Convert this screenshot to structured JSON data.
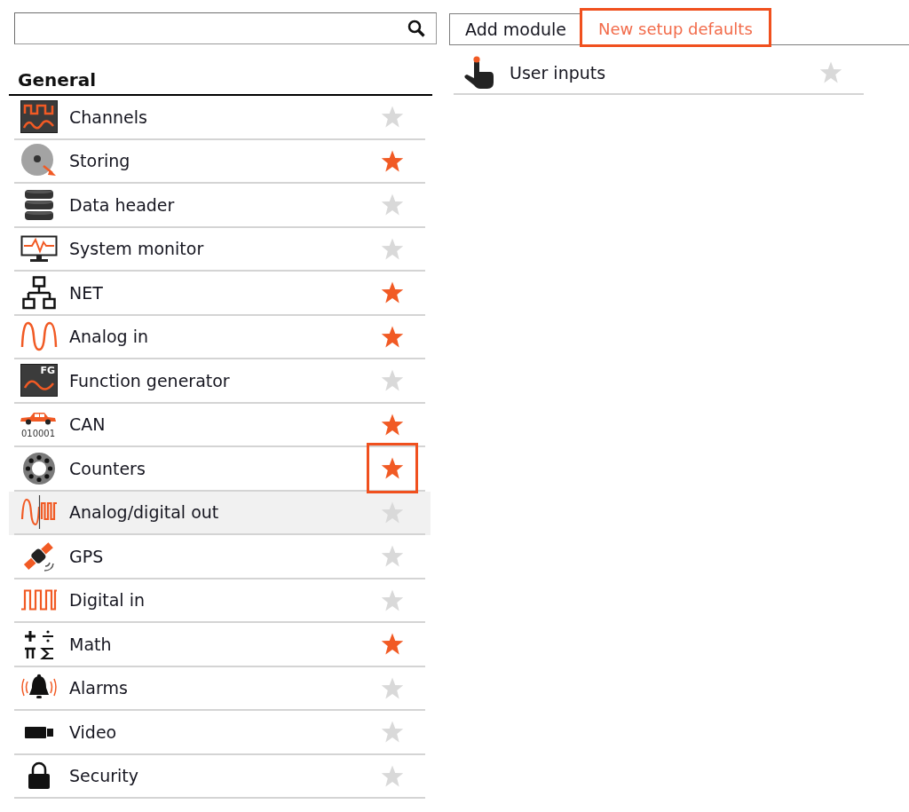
{
  "sidebar": {
    "title": "General",
    "items": [
      {
        "label": "Channels",
        "favorite": false,
        "selected": false,
        "highlighted": false
      },
      {
        "label": "Storing",
        "favorite": true,
        "selected": false,
        "highlighted": false
      },
      {
        "label": "Data header",
        "favorite": false,
        "selected": false,
        "highlighted": false
      },
      {
        "label": "System monitor",
        "favorite": false,
        "selected": false,
        "highlighted": false
      },
      {
        "label": "NET",
        "favorite": true,
        "selected": false,
        "highlighted": false
      },
      {
        "label": "Analog in",
        "favorite": true,
        "selected": false,
        "highlighted": false
      },
      {
        "label": "Function generator",
        "icon_text": "FG",
        "favorite": false,
        "selected": false,
        "highlighted": false
      },
      {
        "label": "CAN",
        "icon_text": "010001",
        "favorite": true,
        "selected": false,
        "highlighted": false
      },
      {
        "label": "Counters",
        "favorite": true,
        "selected": false,
        "highlighted": true
      },
      {
        "label": "Analog/digital out",
        "favorite": false,
        "selected": true,
        "highlighted": false
      },
      {
        "label": "GPS",
        "favorite": false,
        "selected": false,
        "highlighted": false
      },
      {
        "label": "Digital in",
        "favorite": false,
        "selected": false,
        "highlighted": false
      },
      {
        "label": "Math",
        "favorite": true,
        "selected": false,
        "highlighted": false
      },
      {
        "label": "Alarms",
        "favorite": false,
        "selected": false,
        "highlighted": false
      },
      {
        "label": "Video",
        "favorite": false,
        "selected": false,
        "highlighted": false
      },
      {
        "label": "Security",
        "favorite": false,
        "selected": false,
        "highlighted": false
      }
    ]
  },
  "tabs": [
    {
      "label": "Add module",
      "selected": false,
      "highlighted": false
    },
    {
      "label": "New setup defaults",
      "selected": true,
      "highlighted": true
    }
  ],
  "modules": [
    {
      "label": "User inputs",
      "favorite": false
    }
  ]
}
